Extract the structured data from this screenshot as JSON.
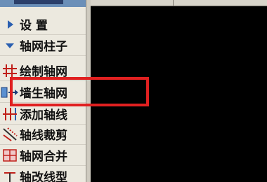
{
  "menu": {
    "items": [
      {
        "label": "设 置",
        "icon": "triangle-right-icon"
      },
      {
        "label": "轴网柱子",
        "icon": "triangle-down-icon"
      },
      {
        "label": "绘制轴网",
        "icon": "grid-draw-icon"
      },
      {
        "label": "墙生轴网",
        "icon": "wall-axis-icon"
      },
      {
        "label": "添加轴线",
        "icon": "add-axis-icon"
      },
      {
        "label": "轴线裁剪",
        "icon": "axis-trim-icon"
      },
      {
        "label": "轴网合并",
        "icon": "axis-merge-icon"
      },
      {
        "label": "轴改线型",
        "icon": "axis-linetype-icon"
      }
    ]
  },
  "colors": {
    "highlight": "#e02020",
    "menu_bg": "#ece9df",
    "canvas_bg": "#000000"
  }
}
